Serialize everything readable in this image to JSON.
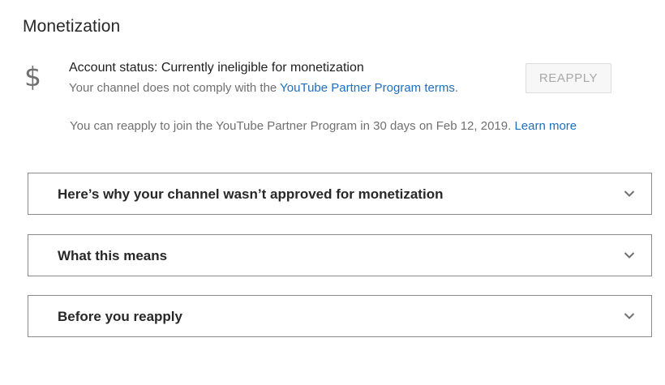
{
  "page": {
    "title": "Monetization"
  },
  "status": {
    "icon": "dollar-icon",
    "icon_glyph": "$",
    "title": "Account status: Currently ineligible for monetization",
    "description_prefix": "Your channel does not comply with the ",
    "terms_link": "YouTube Partner Program terms",
    "description_suffix": ".",
    "reapply_button": "REAPPLY",
    "note_text": "You can reapply to join the YouTube Partner Program in 30 days on Feb 12, 2019. ",
    "learn_more_link": "Learn more"
  },
  "panels": [
    {
      "title": "Here’s why your channel wasn’t approved for monetization",
      "icon": "chevron-down-icon"
    },
    {
      "title": "What this means",
      "icon": "chevron-down-icon"
    },
    {
      "title": "Before you reapply",
      "icon": "chevron-down-icon"
    }
  ],
  "colors": {
    "link": "#1e6fbf",
    "muted_text": "#707070",
    "panel_border": "#8a8a8a",
    "disabled_button_text": "#a8a8a8"
  }
}
